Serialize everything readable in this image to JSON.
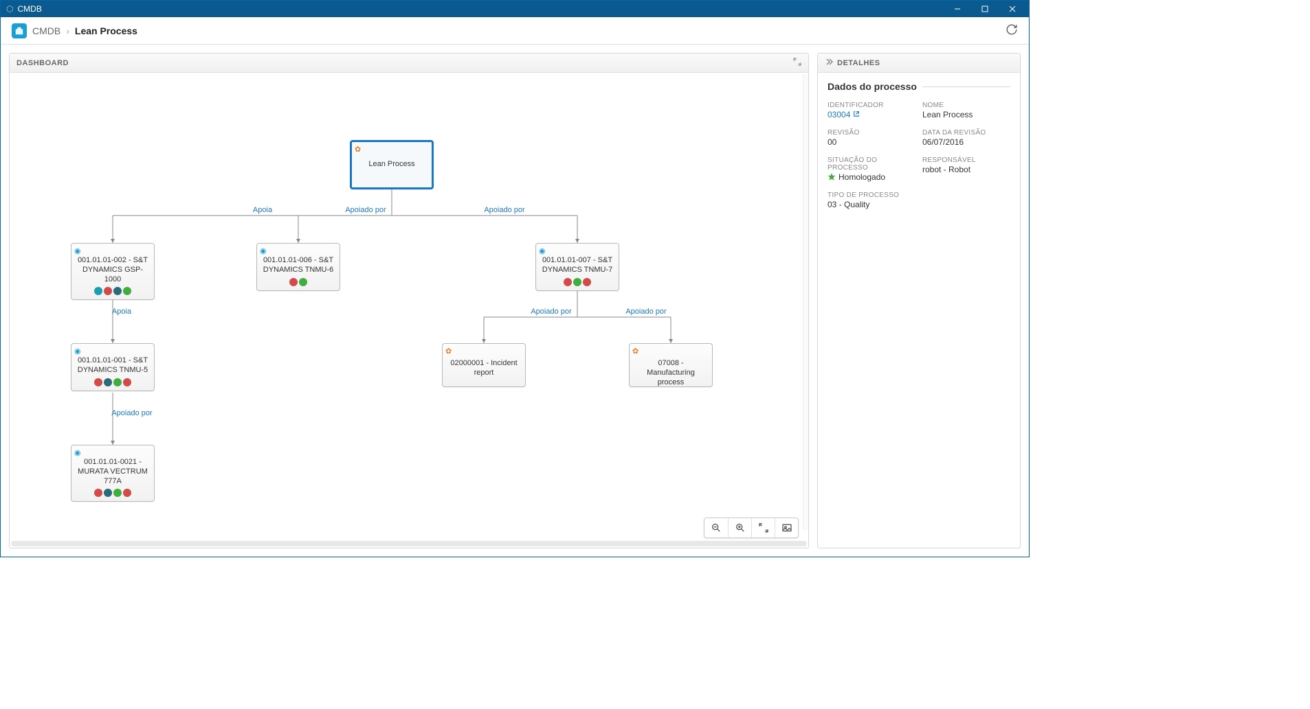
{
  "window": {
    "title": "CMDB"
  },
  "breadcrumb": {
    "root": "CMDB",
    "current": "Lean Process"
  },
  "dashboard": {
    "title": "DASHBOARD"
  },
  "details": {
    "panel_title": "DETALHES",
    "section_title": "Dados do processo",
    "fields": {
      "identificador_label": "IDENTIFICADOR",
      "identificador_value": "03004",
      "nome_label": "NOME",
      "nome_value": "Lean Process",
      "revisao_label": "REVISÃO",
      "revisao_value": "00",
      "data_revisao_label": "DATA DA REVISÃO",
      "data_revisao_value": "06/07/2016",
      "situacao_label": "SITUAÇÃO DO PROCESSO",
      "situacao_value": "Homologado",
      "responsavel_label": "RESPONSÁVEL",
      "responsavel_value": "robot - Robot",
      "tipo_label": "TIPO DE PROCESSO",
      "tipo_value": "03 - Quality"
    }
  },
  "edges": {
    "apoia_root_1": "Apoia",
    "apoiado_root_2": "Apoiado por",
    "apoiado_root_3": "Apoiado por",
    "apoia_1_4": "Apoia",
    "apoiado_4_5": "Apoiado por",
    "apoiado_3_6": "Apoiado por",
    "apoiado_3_7": "Apoiado por"
  },
  "nodes": {
    "root": "Lean Process",
    "n1": "001.01.01-002 - S&T DYNAMICS GSP-1000",
    "n2": "001.01.01-006 - S&T DYNAMICS TNMU-6",
    "n3": "001.01.01-007 - S&T DYNAMICS TNMU-7",
    "n4": "001.01.01-001 - S&T DYNAMICS TNMU-5",
    "n5": "001.01.01-0021 - MURATA VECTRUM 777A",
    "n6": "02000001 - Incident report",
    "n7": "07008 - Manufacturing process"
  }
}
